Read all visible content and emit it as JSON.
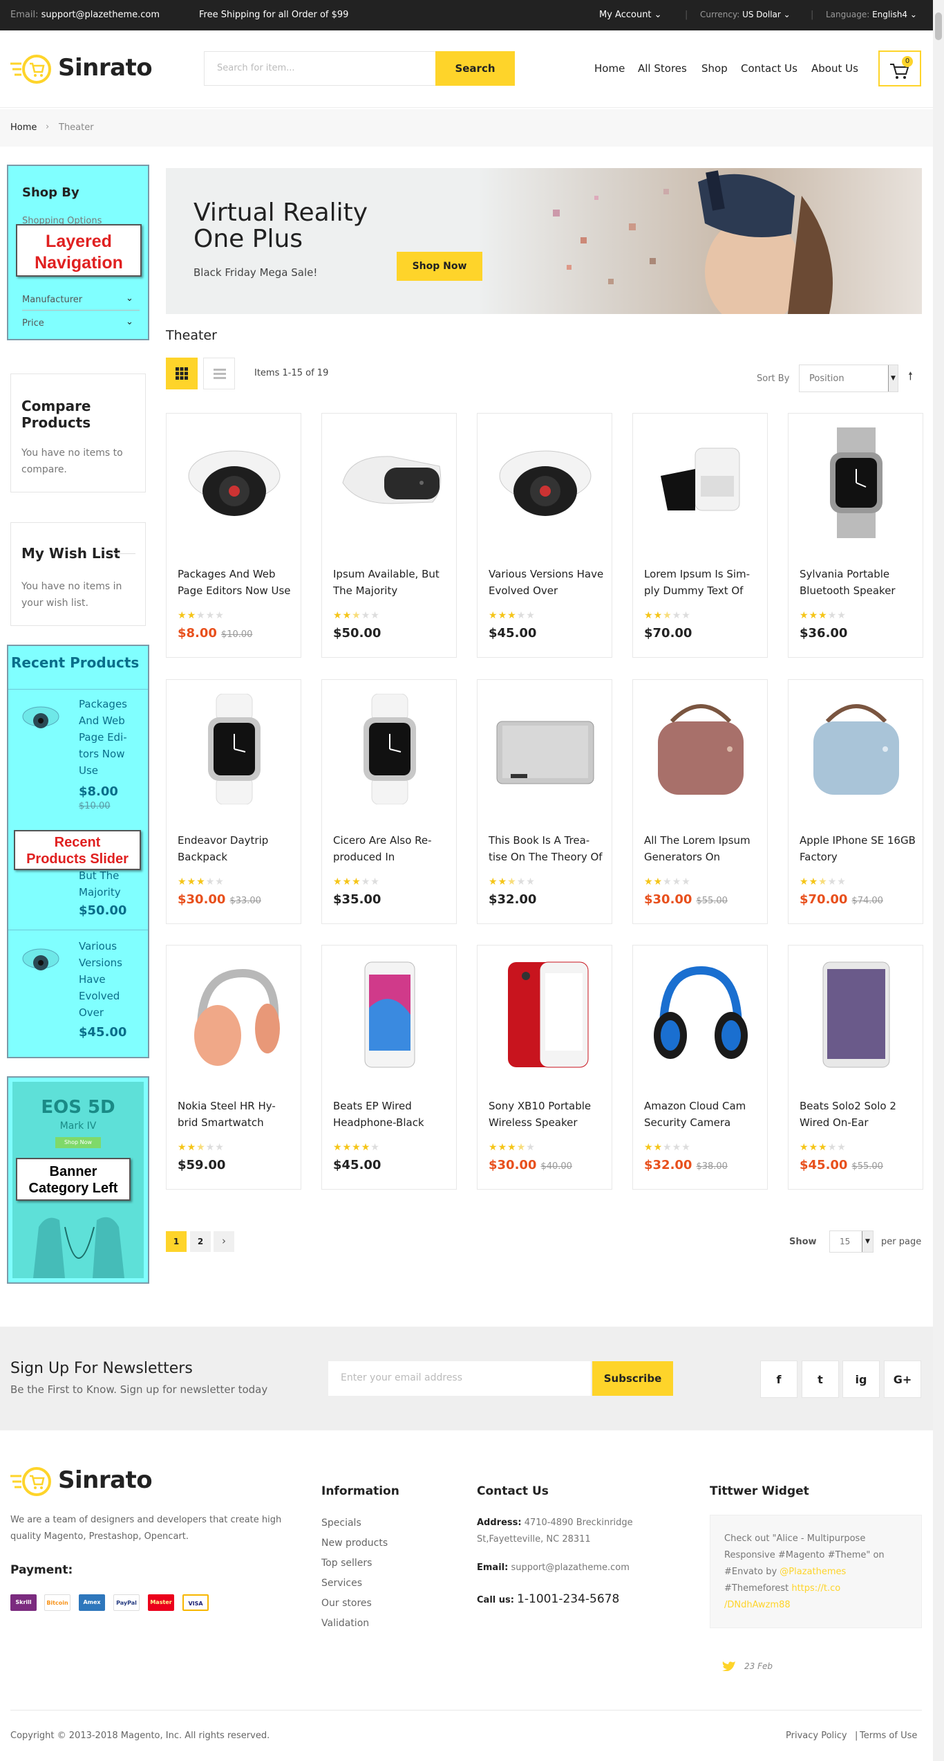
{
  "topbar": {
    "email_label": "Email:",
    "email": "support@plazetheme.com",
    "shipping": "Free Shipping for all Order of $99",
    "account": "My Account",
    "currency_label": "Currency:",
    "currency": "US Dollar",
    "language_label": "Language:",
    "language": "English4"
  },
  "header": {
    "logo": "Sinrato",
    "search_placeholder": "Search for item...",
    "search_button": "Search",
    "nav": [
      "Home",
      "All Stores",
      "Shop",
      "Contact Us",
      "About Us"
    ],
    "cart_count": "0"
  },
  "breadcrumb": {
    "home": "Home",
    "separator": "›",
    "current": "Theater"
  },
  "sidebar": {
    "shop_by": {
      "title": "Shop By",
      "options": "Shopping Options",
      "filters": [
        "Manufacturer",
        "Price"
      ],
      "overlay_label_line1": "Layered",
      "overlay_label_line2": "Navigation"
    },
    "compare": {
      "title_line1": "Compare",
      "title_line2": "Products",
      "text_line1": "You have no items to",
      "text_line2": "compare."
    },
    "wishlist": {
      "title": "My Wish List",
      "text_line1": "You have no items in",
      "text_line2": "your wish list."
    },
    "recent": {
      "title": "Recent Products",
      "overlay_label_line1": "Recent",
      "overlay_label_line2": "Products Slider",
      "items": [
        {
          "name_lines": [
            "Packages",
            "And Web",
            "Page Edi-",
            "tors Now",
            "Use"
          ],
          "price": "$8.00",
          "old_price": "$10.00"
        },
        {
          "name_lines": [
            "But The",
            "Majority"
          ],
          "price": "$50.00"
        },
        {
          "name_lines": [
            "Various",
            "Versions",
            "Have",
            "Evolved",
            "Over"
          ],
          "price": "$45.00"
        }
      ]
    },
    "banner": {
      "heading": "EOS 5D",
      "sub": "Mark IV",
      "button": "Shop Now",
      "overlay_label_line1": "Banner",
      "overlay_label_line2": "Category Left"
    }
  },
  "hero": {
    "title_line1": "Virtual Reality",
    "title_line2": "One Plus",
    "subtitle": "Black Friday Mega Sale!",
    "button": "Shop Now"
  },
  "catalog": {
    "title": "Theater",
    "items_text": "Items 1-15 of 19",
    "sort_label": "Sort By",
    "sort_value": "Position",
    "products": [
      {
        "name_lines": [
          "Packages And Web",
          "Page Editors Now Use"
        ],
        "price": "$8.00",
        "old_price": "$10.00",
        "rating": 2,
        "image": "dome-camera"
      },
      {
        "name_lines": [
          "Ipsum Available, But",
          "The Majority"
        ],
        "price": "$50.00",
        "rating": 2.5,
        "image": "vr-headset-white"
      },
      {
        "name_lines": [
          "Various Versions Have",
          "Evolved Over"
        ],
        "price": "$45.00",
        "rating": 3,
        "image": "dome-camera"
      },
      {
        "name_lines": [
          "Lorem Ipsum Is Sim-",
          "ply Dummy Text Of"
        ],
        "price": "$70.00",
        "rating": 2.5,
        "image": "vr-headset-black"
      },
      {
        "name_lines": [
          "Sylvania Portable",
          "Bluetooth Speaker"
        ],
        "price": "$36.00",
        "rating": 3,
        "image": "smartwatch-grey"
      },
      {
        "name_lines": [
          "Endeavor Daytrip",
          "Backpack"
        ],
        "price": "$30.00",
        "old_price": "$33.00",
        "rating": 3,
        "image": "smartwatch-white"
      },
      {
        "name_lines": [
          "Cicero Are Also Re-",
          "produced In"
        ],
        "price": "$35.00",
        "rating": 3,
        "image": "smartwatch-white"
      },
      {
        "name_lines": [
          "This Book Is A Trea-",
          "tise On The Theory Of"
        ],
        "price": "$32.00",
        "rating": 2.5,
        "image": "speaker-grey"
      },
      {
        "name_lines": [
          "All The Lorem Ipsum",
          "Generators On"
        ],
        "price": "$30.00",
        "old_price": "$55.00",
        "rating": 2,
        "image": "speaker-brown"
      },
      {
        "name_lines": [
          "Apple IPhone SE 16GB",
          "Factory"
        ],
        "price": "$70.00",
        "old_price": "$74.00",
        "rating": 2.5,
        "image": "speaker-blue"
      },
      {
        "name_lines": [
          "Nokia Steel HR Hy-",
          "brid Smartwatch"
        ],
        "price": "$59.00",
        "rating": 2.5,
        "image": "headphones-peach"
      },
      {
        "name_lines": [
          "Beats EP Wired",
          "Headphone-Black"
        ],
        "price": "$45.00",
        "rating": 4,
        "image": "iphone-silver"
      },
      {
        "name_lines": [
          "Sony XB10 Portable",
          "Wireless Speaker"
        ],
        "price": "$30.00",
        "old_price": "$40.00",
        "rating": 3.5,
        "image": "iphone-red"
      },
      {
        "name_lines": [
          "Amazon Cloud Cam",
          "Security Camera"
        ],
        "price": "$32.00",
        "old_price": "$38.00",
        "rating": 2,
        "image": "headphones-blue"
      },
      {
        "name_lines": [
          "Beats Solo2 Solo 2",
          "Wired On-Ear"
        ],
        "price": "$45.00",
        "old_price": "$55.00",
        "rating": 3,
        "image": "ipad"
      }
    ],
    "pages": [
      "1",
      "2"
    ],
    "next": "›",
    "show_label": "Show",
    "per_page_value": "15",
    "per_page_label": "per page"
  },
  "newsletter": {
    "title": "Sign Up For Newsletters",
    "subtitle": "Be the First to Know. Sign up for newsletter today",
    "placeholder": "Enter your email address",
    "button": "Subscribe",
    "social": [
      "f",
      "t",
      "ig",
      "G+"
    ]
  },
  "footer": {
    "about_line1": "We are a team of designers and developers that create high",
    "about_line2": "quality Magento, Prestashop, Opencart.",
    "payment_label": "Payment:",
    "payments": [
      "Skrill",
      "Bitcoin",
      "Amex",
      "PayPal",
      "Master",
      "VISA"
    ],
    "info_title": "Information",
    "info_links": [
      "Specials",
      "New products",
      "Top sellers",
      "Services",
      "Our stores",
      "Validation"
    ],
    "contact_title": "Contact Us",
    "address_label": "Address:",
    "address_line1": "4710-4890 Breckinridge",
    "address_line2": "St,Fayetteville, NC 28311",
    "email_label": "Email:",
    "email": "support@plazatheme.com",
    "call_label": "Call us:",
    "phone": "1-1001-234-5678",
    "twitter_title": "Tittwer Widget",
    "tweet_line1": "Check out \"Alice - Multipurpose",
    "tweet_line2": "Responsive #Magento #Theme\" on",
    "tweet_line3_a": "#Envato by ",
    "tweet_line3_b": "@Plazathemes",
    "tweet_line4_a": "#Themeforest ",
    "tweet_line4_b": "https://t.co",
    "tweet_line5": "/DNdhAwzm88",
    "tweet_date": "23 Feb",
    "copyright": "Copyright © 2013-2018 Magento, Inc. All rights reserved.",
    "privacy": "Privacy Policy",
    "bar": "|",
    "terms": "Terms of Use"
  },
  "colors": {
    "accent": "#fed42a",
    "sale": "#e8501d",
    "cyan_overlay": "#80ffff",
    "label_red": "#e02020"
  }
}
